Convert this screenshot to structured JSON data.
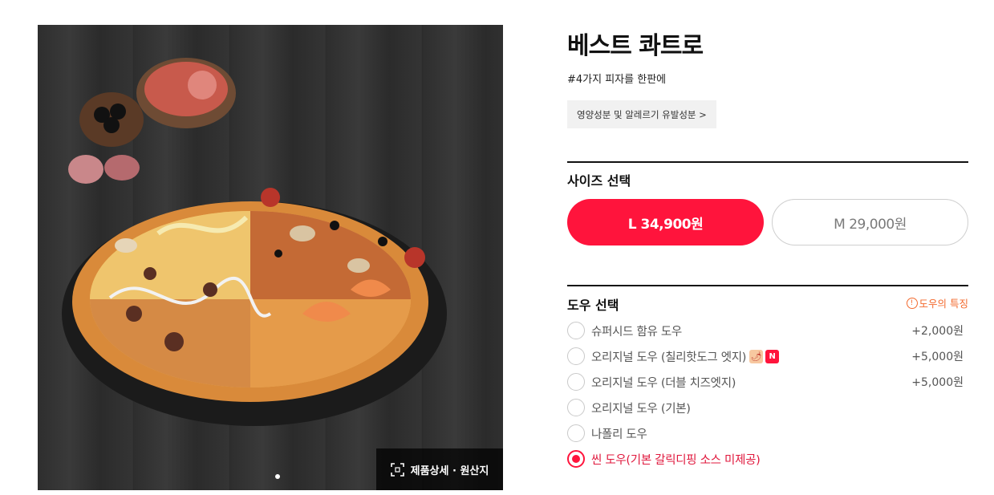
{
  "product": {
    "title": "베스트 콰트로",
    "tagline": "#4가지 피자를 한판에",
    "nutrition_button": "영양성분 및 알레르기 유발성분 >",
    "detail_button": "제품상세 · 원산지"
  },
  "size": {
    "label": "사이즈 선택",
    "options": [
      {
        "label": "L 34,900원",
        "selected": true
      },
      {
        "label": "M 29,000원",
        "selected": false
      }
    ]
  },
  "dough": {
    "label": "도우 선택",
    "info_link": "도우의 특징",
    "options": [
      {
        "name": "슈퍼시드 함유 도우",
        "price": "+2,000원",
        "selected": false
      },
      {
        "name": "오리지널 도우 (칠리핫도그 엣지)",
        "price": "+5,000원",
        "selected": false,
        "badges": [
          "chili-icon",
          "N"
        ]
      },
      {
        "name": "오리지널 도우 (더블 치즈엣지)",
        "price": "+5,000원",
        "selected": false
      },
      {
        "name": "오리지널 도우 (기본)",
        "price": "",
        "selected": false
      },
      {
        "name": "나폴리 도우",
        "price": "",
        "selected": false
      },
      {
        "name": "씬 도우(기본 갈릭디핑 소스 미제공)",
        "price": "",
        "selected": true
      }
    ]
  },
  "colors": {
    "accent": "#ff143c",
    "info_orange": "#f36a2e",
    "rule": "#111111"
  }
}
